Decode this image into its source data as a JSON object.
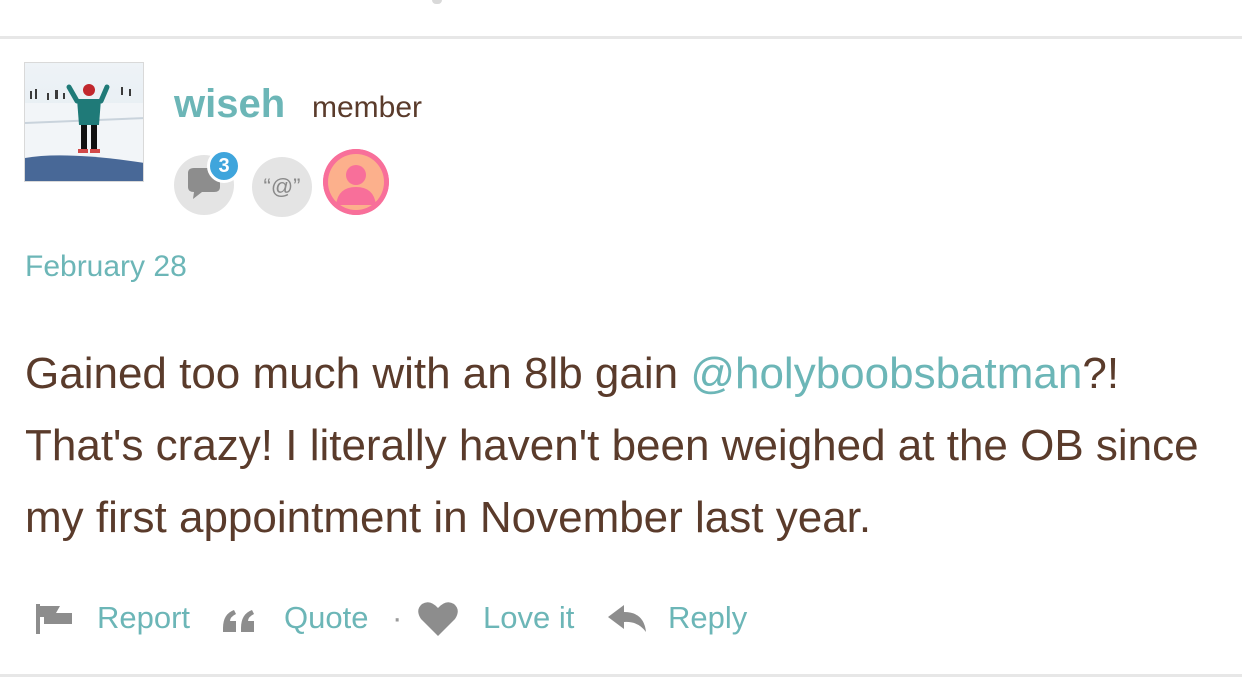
{
  "post": {
    "author": {
      "name": "wiseh",
      "role": "member",
      "avatar_icon": "avatar-photo-skier"
    },
    "badges": {
      "comments_count": "3",
      "comments_icon": "speech-bubble-icon",
      "mention_text": "“@”",
      "profile_icon": "person-silhouette-icon"
    },
    "date": "February 28",
    "body": {
      "text_before": "Gained too much with an 8lb gain ",
      "mention": "@holyboobsbatman",
      "text_after": "?! That's crazy! I literally haven't been weighed at the OB since my first appointment in November last year."
    },
    "actions": {
      "report": "Report",
      "quote": "Quote",
      "separator": "·",
      "love": "Love it",
      "reply": "Reply"
    }
  },
  "colors": {
    "accent": "#6cb6b7",
    "text": "#5a3b2b",
    "divider": "#e7e7e7",
    "badge_bubble": "#3fa5dc",
    "profile_pink": "#f86f9a"
  }
}
